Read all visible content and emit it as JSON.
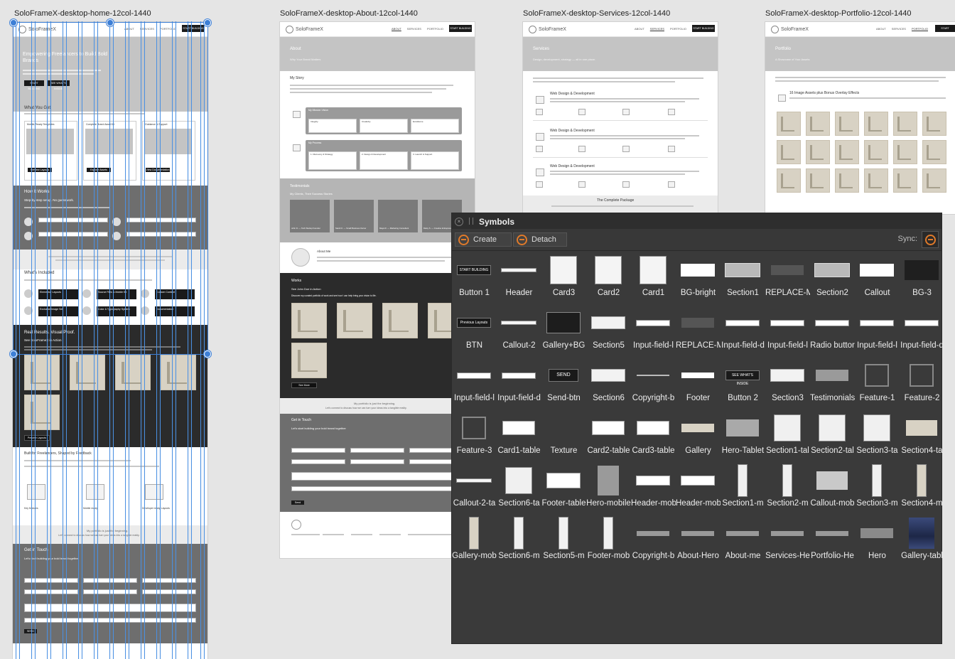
{
  "artboards": [
    {
      "title": "SoloFrameX-desktop-home-12col-1440"
    },
    {
      "title": "SoloFrameX-desktop-About-12col-1440"
    },
    {
      "title": "SoloFrameX-desktop-Services-12col-1440"
    },
    {
      "title": "SoloFrameX-desktop-Portfolio-12col-1440"
    }
  ],
  "brand": "SoloFrameX",
  "nav": [
    "ABOUT",
    "SERVICES",
    "PORTFOLIO"
  ],
  "nav_cta": "START BUILDING",
  "home": {
    "hero_title": "Empowering Freelancers to Build Bold Brands",
    "hero_btn1": "START BUILDING",
    "hero_btn2": "SEE WHAT'S INSIDE",
    "what_title": "What You Get",
    "what_sub": "Smart, scalable solutions to design, customize, and launch your brand in one day.",
    "cards": [
      "Mobile-Ready Templates",
      "Complete Brand Asset Kit",
      "Guidance & Support"
    ],
    "card_btns": [
      "Preview Layouts",
      "Explore Assets",
      "View Documentation"
    ],
    "how_title": "How It Works",
    "how_sub": "Step-by-step setup. No guesswork.",
    "steps": [
      "1. Launch Quick",
      "2. Product Folder",
      "3. Assets",
      "4. Show Craft"
    ],
    "callout": "No bloated themes or confusing builders. Just a clean, modular system that works as-is through setup, customization, and launch — all in under one hour.",
    "included_title": "What's Included",
    "included_sub": "Everything you need to design, customize, and launch your brand — in one complete package.",
    "included": [
      "Elementor Layouts",
      "Source Files & Mobile Kit",
      "Custom Content",
      "Exclusive Image Set",
      "Color & Typography System",
      "Documentation"
    ],
    "proof_title": "Real Results. Visual Proof.",
    "proof_sub": "See SoloFrameX in Action",
    "proof_btn": "Preview Layouts",
    "built_title": "Built for Freelancers, Shaped by Feedback",
    "built_items": [
      "Key features",
      "Mobile ready",
      "Developer ready Layouts"
    ],
    "portfolio_line": "My portfolio is just the beginning.",
    "portfolio_line2": "Let's connect to discuss how we can turn your ideas into a tangible reality.",
    "contact_title": "Get in Touch",
    "contact_sub": "Let's start building your bold brand together",
    "send": "SEND"
  },
  "about": {
    "title": "About",
    "subtitle": "Why Your Brand Matters",
    "story": "My Story",
    "mission": "My Mission Vision",
    "values": [
      "Integrity",
      "Creativity",
      "Excellence"
    ],
    "process": "My Process",
    "process_steps": [
      "1. Discovery & Strategy",
      "2. Design & Development",
      "3. Launch & Support"
    ],
    "testimonials": "Testimonials",
    "testimonials_sub": "My Clients, Their Success Stories",
    "authors": [
      "John D. — Tech Startup Founder",
      "Sarah K. — Small Business Owner",
      "Maya R. — Marketing Consultant",
      "Daisy S. — Creative Entrepreneur"
    ],
    "about_me": "About Me",
    "works": "Works",
    "works_sub": "See John Doe in Action",
    "works_desc": "Discover my curated portfolio of work and see how I can help bring your vision to life.",
    "see_more": "See More",
    "portfolio_line": "My portfolio is just the beginning.",
    "portfolio_line2": "Let's connect to discuss how we can turn your ideas into a tangible reality.",
    "contact": "Get in Touch",
    "contact_sub": "Let's start building your bold brand together",
    "send": "Send"
  },
  "services": {
    "title": "Services",
    "subtitle": "Design, development, strategy — all in one place.",
    "items": [
      "Web Design & Development",
      "Web Design & Development",
      "Web Design & Development"
    ],
    "package": "The Complete Package"
  },
  "portfolio": {
    "title": "Portfolio",
    "subtitle": "A Showcase of Your Assets",
    "gallery_title": "16 Image Assets plus Bonus Overlay Effects"
  },
  "symbols_panel": {
    "title": "Symbols",
    "create": "Create",
    "detach": "Detach",
    "sync": "Sync:",
    "items": [
      "Button 1",
      "Header",
      "Card3",
      "Card2",
      "Card1",
      "BG-bright",
      "Section1",
      "REPLACE-M",
      "Section2",
      "Callout",
      "BG-3",
      "BTN",
      "Callout-2",
      "Gallery+BG",
      "Section5",
      "Input-field-l",
      "REPLACE-M",
      "Input-field-d",
      "Input-field-l",
      "Radio buttor",
      "Input-field-l",
      "Input-field-d",
      "Input-field-l",
      "Input-field-d",
      "Send-btn",
      "Section6",
      "Copyright-b",
      "Footer",
      "Button 2",
      "Section3",
      "Testimonials",
      "Feature-1",
      "Feature-2",
      "Feature-3",
      "Card1-table",
      "Texture",
      "Card2-table",
      "Card3-table",
      "Gallery",
      "Hero-Tablet",
      "Section1-tal",
      "Section2-tal",
      "Section3-ta",
      "Section4-ta",
      "Callout-2-ta",
      "Section6-ta",
      "Footer-table",
      "Hero-mobile",
      "Header-mob",
      "Header-mob",
      "Section1-m",
      "Section2-m",
      "Callout-mob",
      "Section3-m",
      "Section4-m",
      "Gallery-mob",
      "Section6-m",
      "Section5-m",
      "Footer-mob",
      "Copyright-b",
      "About-Hero",
      "About-me",
      "Services-He",
      "Portfolio-He",
      "Hero",
      "Gallery-tabl"
    ],
    "thumb_labels": {
      "start_building": "START BUILDING",
      "previous_layouts": "Previous Layouts",
      "send": "SEND",
      "see_whats_inside": "SEE WHAT'S INSIDE"
    }
  }
}
